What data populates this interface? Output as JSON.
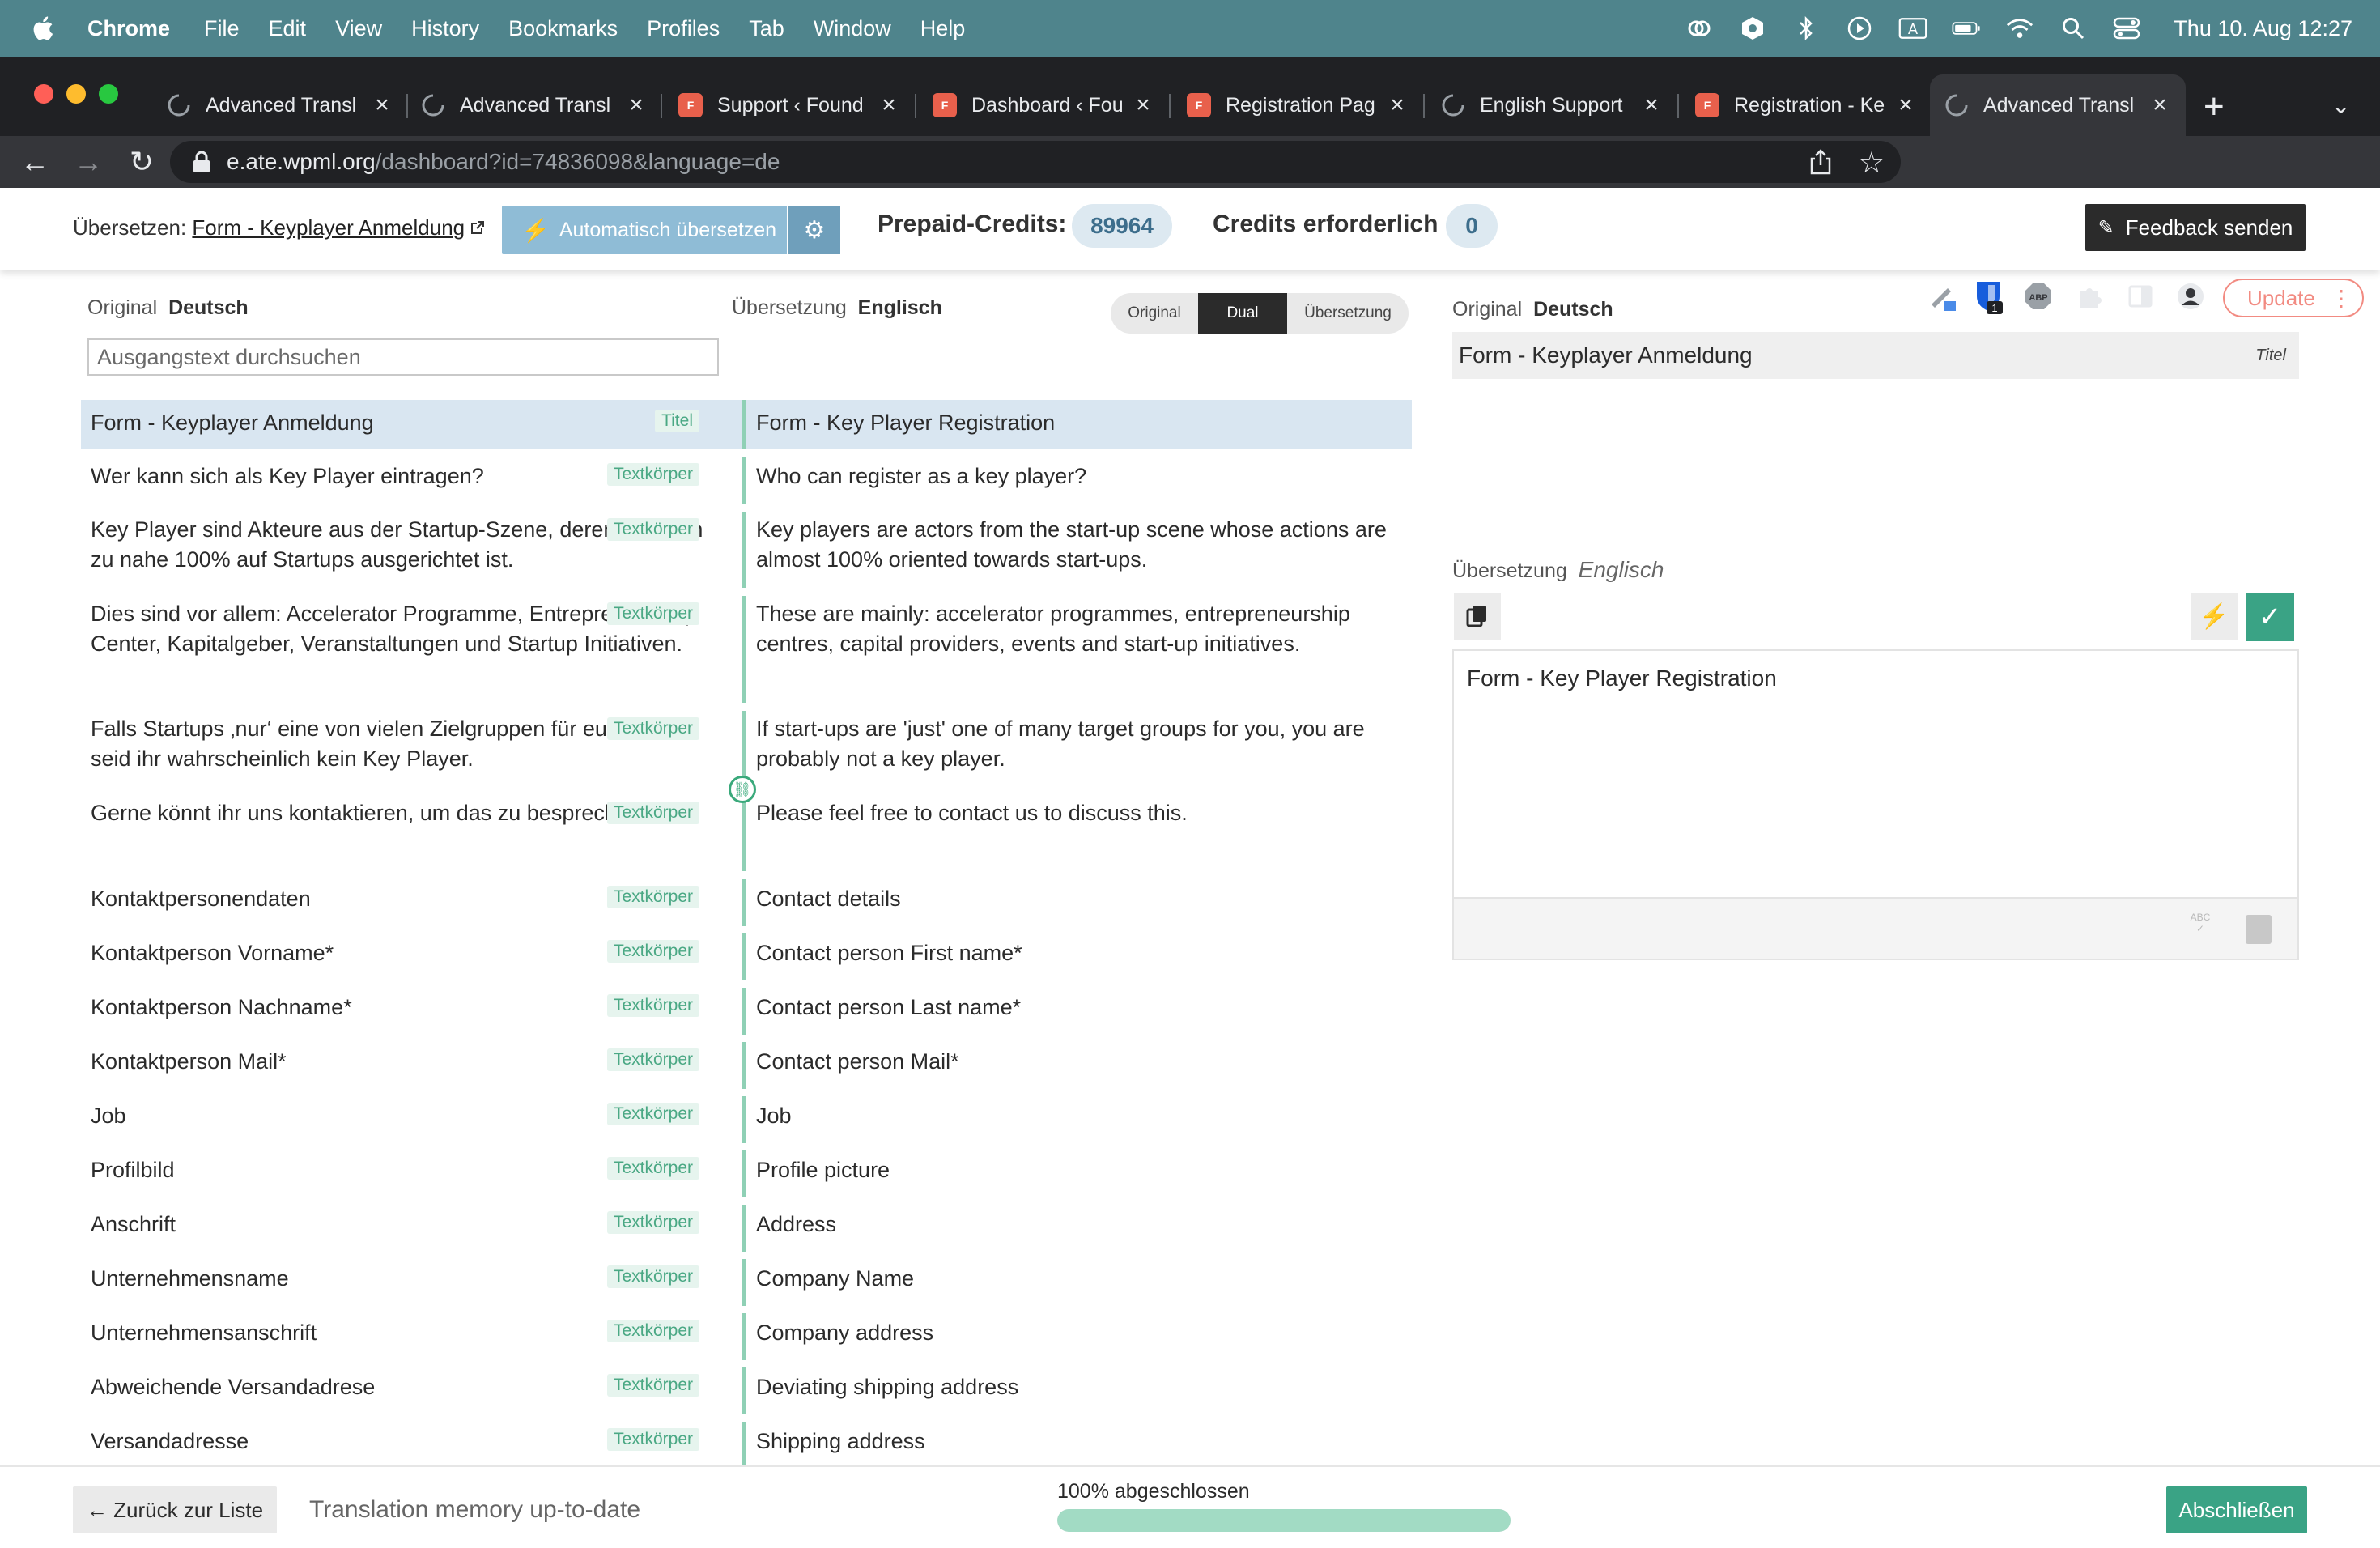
{
  "menubar": {
    "app": "Chrome",
    "items": [
      "File",
      "Edit",
      "View",
      "History",
      "Bookmarks",
      "Profiles",
      "Tab",
      "Window",
      "Help"
    ],
    "clock": "Thu 10. Aug  12:27"
  },
  "tabs": [
    {
      "title": "Advanced Transl",
      "favicon": "loading-icon"
    },
    {
      "title": "Advanced Transl",
      "favicon": "loading-icon"
    },
    {
      "title": "Support ‹ Found",
      "favicon": "site-logo-icon"
    },
    {
      "title": "Dashboard ‹ Fou",
      "favicon": "site-logo-icon"
    },
    {
      "title": "Registration Pag",
      "favicon": "site-logo-icon"
    },
    {
      "title": "English Support",
      "favicon": "loading-icon"
    },
    {
      "title": "Registration - Ke",
      "favicon": "site-logo-icon"
    },
    {
      "title": "Advanced Transl",
      "favicon": "loading-icon",
      "active": true
    }
  ],
  "omnibox": {
    "host": "e.ate.wpml.org",
    "path": "/dashboard?id=74836098&language=de"
  },
  "toolbar": {
    "update_label": "Update",
    "ext_badge": "1"
  },
  "header": {
    "translate_prefix": "Übersetzen:",
    "document_link": "Form - Keyplayer Anmeldung",
    "auto_translate_label": "Automatisch übersetzen",
    "prepaid_credits_label": "Prepaid-Credits:",
    "prepaid_credits_value": "89964",
    "credits_required_label": "Credits erforderlich",
    "credits_required_value": "0",
    "feedback_label": "Feedback senden"
  },
  "editor": {
    "original_label": "Original",
    "original_lang": "Deutsch",
    "translation_label": "Übersetzung",
    "translation_lang": "Englisch",
    "search_placeholder": "Ausgangstext durchsuchen",
    "view_modes": [
      "Original",
      "Dual",
      "Übersetzung"
    ],
    "active_view": "Dual",
    "rows": [
      {
        "src": "Form - Keyplayer Anmeldung",
        "tag": "Titel",
        "tgt": "Form - Key Player Registration",
        "selected": true
      },
      {
        "src": "Wer kann sich als Key Player eintragen?",
        "tag": "Textkörper",
        "tgt": "Who can register as a key player?"
      },
      {
        "src": "Key Player sind Akteure aus der Startup-Szene, deren Handeln zu nahe 100% auf Startups ausgerichtet ist.",
        "tag": "Textkörper",
        "tgt": "Key players are actors from the start-up scene whose actions are almost 100% oriented towards start-ups."
      },
      {
        "src": "Dies sind vor allem: Accelerator Programme, Entrepreneurship Center, Kapitalgeber, Veranstaltungen und Startup Initiativen.",
        "tag": "Textkörper",
        "tgt": "These are mainly: accelerator programmes, entrepreneurship centres, capital providers, events and start-up initiatives."
      },
      {
        "src": "Falls Startups ‚nur‘ eine von vielen Zielgruppen für euch ist, seid ihr wahrscheinlich kein Key Player.",
        "tag": "Textkörper",
        "tgt": "If start-ups are 'just' one of many target groups for you, you are probably not a key player."
      },
      {
        "src": "Gerne könnt ihr uns kontaktieren, um das zu besprechen.",
        "tag": "Textkörper",
        "tgt": "Please feel free to contact us to discuss this."
      },
      {
        "src": "Kontaktpersonendaten",
        "tag": "Textkörper",
        "tgt": "Contact details"
      },
      {
        "src": "Kontaktperson Vorname*",
        "tag": "Textkörper",
        "tgt": "Contact person First name*"
      },
      {
        "src": "Kontaktperson Nachname*",
        "tag": "Textkörper",
        "tgt": "Contact person Last name*"
      },
      {
        "src": "Kontaktperson Mail*",
        "tag": "Textkörper",
        "tgt": "Contact person Mail*"
      },
      {
        "src": "Job",
        "tag": "Textkörper",
        "tgt": "Job"
      },
      {
        "src": "Profilbild",
        "tag": "Textkörper",
        "tgt": "Profile picture"
      },
      {
        "src": "Anschrift",
        "tag": "Textkörper",
        "tgt": "Address"
      },
      {
        "src": "Unternehmensname",
        "tag": "Textkörper",
        "tgt": "Company Name"
      },
      {
        "src": "Unternehmensanschrift",
        "tag": "Textkörper",
        "tgt": "Company address"
      },
      {
        "src": "Abweichende Versandadrese",
        "tag": "Textkörper",
        "tgt": "Deviating shipping address"
      },
      {
        "src": "Versandadresse",
        "tag": "Textkörper",
        "tgt": "Shipping address"
      }
    ]
  },
  "panel": {
    "original_label": "Original",
    "original_lang": "Deutsch",
    "original_text": "Form - Keyplayer Anmeldung",
    "original_tag": "Titel",
    "translation_label": "Übersetzung",
    "translation_lang": "Englisch",
    "translation_text": "Form - Key Player Registration",
    "spellcheck_caption": "ABC"
  },
  "footer": {
    "back_label": "← Zurück zur Liste",
    "tm_status": "Translation memory up-to-date",
    "progress_label": "100% abgeschlossen",
    "progress_fraction": 1.0,
    "finish_label": "Abschließen"
  },
  "colors": {
    "accent_green": "#3aa385",
    "selected_row": "#d9e6f1",
    "auto_translate": "#8fbcd6",
    "menubar": "#4f848c"
  }
}
